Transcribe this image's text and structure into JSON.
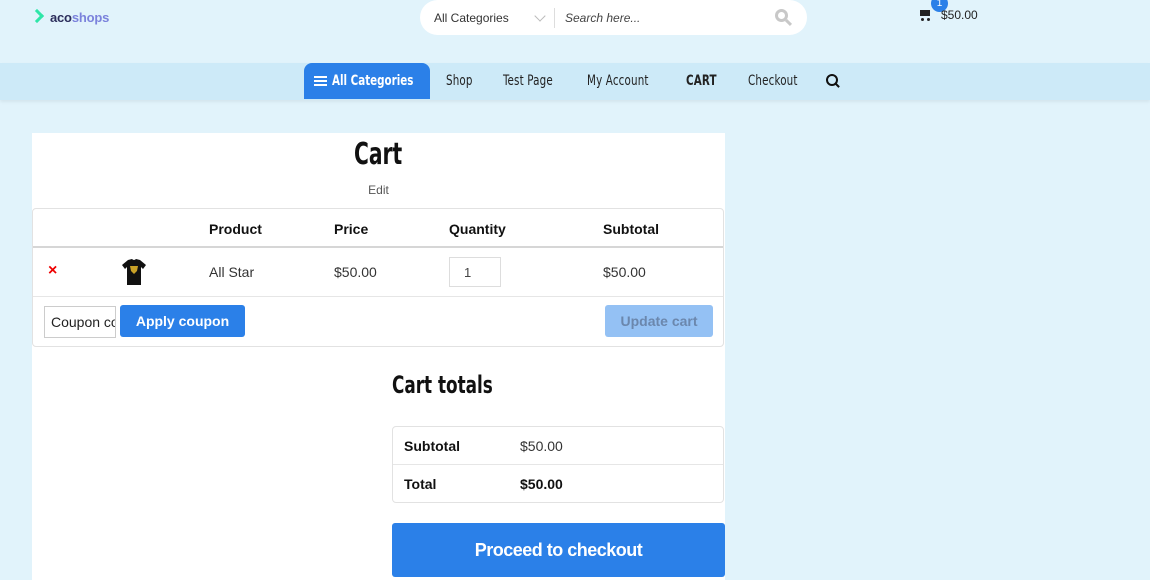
{
  "header": {
    "logo": {
      "part1": "aco",
      "part2": "shops"
    },
    "search": {
      "category_selected": "All Categories",
      "placeholder": "Search here..."
    },
    "mini_cart": {
      "count": "1",
      "total": "$50.00"
    }
  },
  "nav": {
    "all_categories": "All Categories",
    "items": [
      "Shop",
      "Test Page",
      "My Account",
      "CART",
      "Checkout"
    ],
    "active": "CART"
  },
  "page": {
    "title": "Cart",
    "edit_link": "Edit"
  },
  "cart_table": {
    "headers": {
      "product": "Product",
      "price": "Price",
      "quantity": "Quantity",
      "subtotal": "Subtotal"
    },
    "rows": [
      {
        "remove": "×",
        "product": "All Star",
        "price": "$50.00",
        "quantity": "1",
        "subtotal": "$50.00"
      }
    ],
    "coupon_placeholder": "Coupon code",
    "apply_coupon": "Apply coupon",
    "update_cart": "Update cart"
  },
  "totals": {
    "title": "Cart totals",
    "subtotal_label": "Subtotal",
    "subtotal_value": "$50.00",
    "total_label": "Total",
    "total_value": "$50.00",
    "checkout_button": "Proceed to checkout"
  },
  "colors": {
    "accent": "#2b80e8",
    "background": "#e1f3fb",
    "remove": "#ee0000"
  }
}
